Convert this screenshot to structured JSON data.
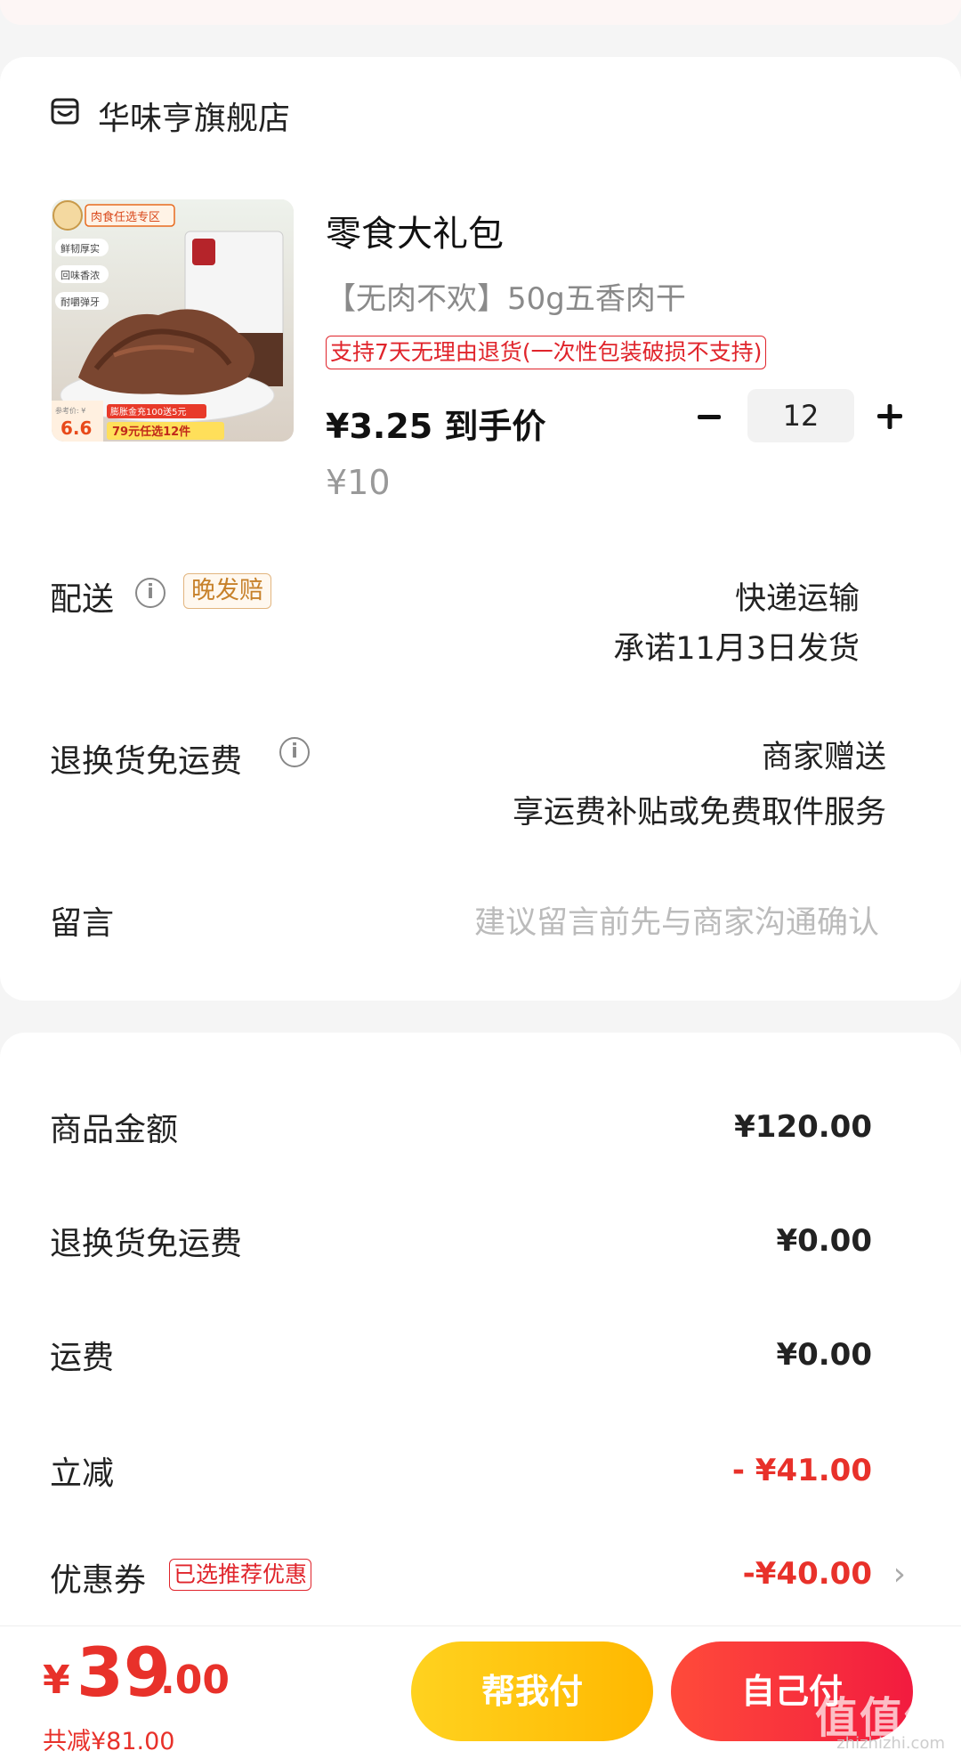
{
  "store": {
    "name": "华味亨旗舰店",
    "icon": "store-icon"
  },
  "product": {
    "title": "零食大礼包",
    "spec": "【无肉不欢】50g五香肉干",
    "return_policy": "支持7天无理由退货(一次性包装破损不支持)",
    "deal_price": "¥3.25 到手价",
    "original_price": "¥10",
    "quantity": "12",
    "image": {
      "banner": "肉食任选专区",
      "features": [
        "鲜韧厚实",
        "回味香浓",
        "耐嚼弹牙"
      ],
      "ref_price_label": "参考价: ¥",
      "ref_price": "6.6",
      "promo1": "膨胀金充100送5元",
      "promo2": "79元任选12件"
    }
  },
  "delivery": {
    "label": "配送",
    "badge": "晚发赔",
    "method": "快递运输",
    "promise": "承诺11月3日发货"
  },
  "return_shipping": {
    "label": "退换货免运费",
    "provider": "商家赠送",
    "desc": "享运费补贴或免费取件服务"
  },
  "message": {
    "label": "留言",
    "placeholder": "建议留言前先与商家沟通确认"
  },
  "summary": {
    "goods_label": "商品金额",
    "goods_value": "¥120.00",
    "return_label": "退换货免运费",
    "return_value": "¥0.00",
    "shipping_label": "运费",
    "shipping_value": "¥0.00",
    "discount_label": "立减",
    "discount_value": "- ¥41.00",
    "coupon_label": "优惠券",
    "coupon_badge": "已选推荐优惠",
    "coupon_value": "-¥40.00"
  },
  "footer": {
    "currency": "¥",
    "total_int": "39",
    "total_dec": ".00",
    "saved": "共减¥81.00",
    "help_pay": "帮我付",
    "self_pay": "自己付"
  },
  "watermark": {
    "main": "值值值",
    "sub": "zhizhizhi.com"
  },
  "colors": {
    "accent_red": "#e8312a",
    "help_yellow": "#ffc21a",
    "badge_orange": "#c7812a"
  }
}
